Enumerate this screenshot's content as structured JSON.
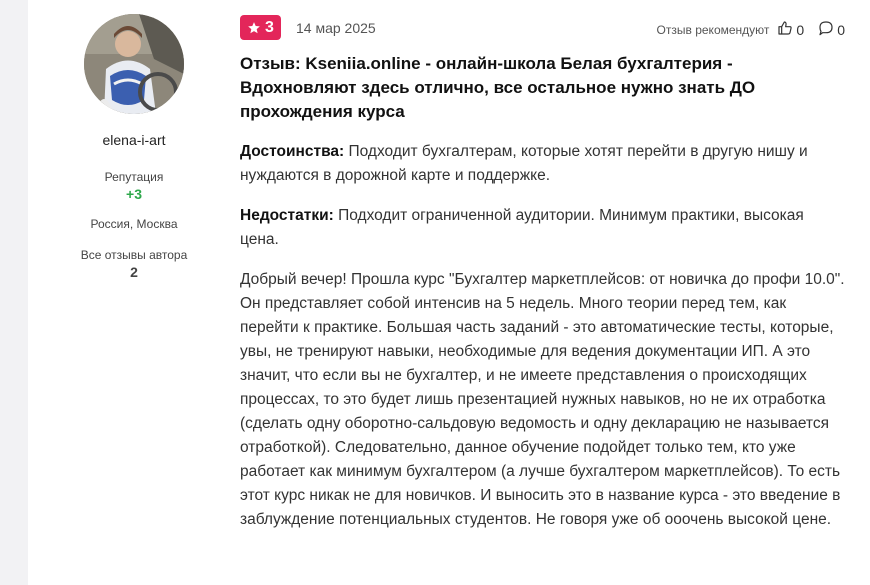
{
  "author": {
    "name": "elena-i-art",
    "reputation_label": "Репутация",
    "reputation_value": "+3",
    "location": "Россия, Москва",
    "all_reviews_label": "Все отзывы автора",
    "all_reviews_count": "2"
  },
  "review": {
    "rating": "3",
    "date": "14 мар 2025",
    "recommend_label": "Отзыв рекомендуют",
    "likes": "0",
    "comments": "0",
    "title": "Отзыв: Kseniia.online - онлайн-школа Белая бухгалтерия - Вдохновляют здесь отлично, все остальное нужно знать ДО прохождения курса",
    "pros_label": "Достоинства:",
    "pros_text": "Подходит бухгалтерам, которые хотят перейти в другую нишу и нуждаются в дорожной карте и поддержке.",
    "cons_label": "Недостатки:",
    "cons_text": "Подходит ограниченной аудитории. Минимум практики, высокая цена.",
    "body": "Добрый вечер! Прошла курс \"Бухгалтер маркетплейсов: от новичка до профи 10.0\". Он представляет собой интенсив на 5 недель. Много теории перед тем, как перейти к практике. Большая часть заданий - это автоматические тесты, которые, увы, не тренируют навыки, необходимые для ведения документации ИП. А это значит, что если вы не бухгалтер, и не имеете представления о происходящих процессах, то это будет лишь презентацией нужных навыков, но не их отработка (сделать одну оборотно-сальдовую ведомость и одну декларацию не называется отработкой). Следовательно, данное обучение подойдет только тем, кто уже работает как минимум бухгалтером (а лучше бухгалтером маркетплейсов). То есть этот курс никак не для новичков. И выносить это в название курса - это введение в заблуждение потенциальных студентов. Не говоря уже об ооочень высокой цене."
  },
  "colors": {
    "rating_badge": "#e3265a",
    "reputation": "#2ea84b"
  },
  "icons": {
    "rating": "star-icon",
    "like": "thumbs-up-icon",
    "comment": "comment-icon"
  }
}
